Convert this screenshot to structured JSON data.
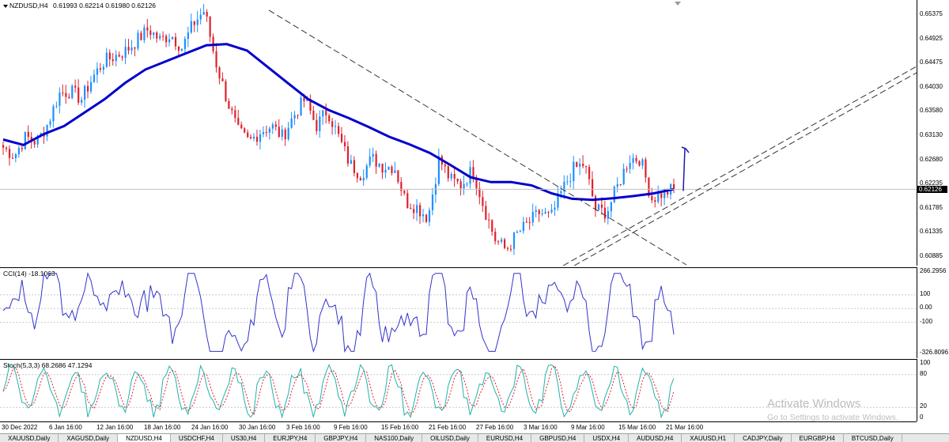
{
  "main": {
    "symbol": "NZDUSD,H4",
    "ohlc": "0.61993 0.62214 0.61980 0.62126",
    "current_price": "0.62126",
    "price_ticks": [
      "0.65375",
      "0.64925",
      "0.64475",
      "0.64030",
      "0.63580",
      "0.63130",
      "0.62680",
      "0.62235",
      "0.61785",
      "0.61335",
      "0.60885"
    ]
  },
  "cci": {
    "title": "CCI(14) -18.1063",
    "ticks": [
      "266.2956",
      "100",
      "0.00",
      "-100",
      "-326.8096"
    ]
  },
  "stoch": {
    "title": "Stoch(5,3,3) 68.2686 47.1294",
    "ticks": [
      "100",
      "80",
      "20",
      "0"
    ]
  },
  "time_axis": [
    "30 Dec 2022",
    "6 Jan 16:00",
    "12 Jan 16:00",
    "18 Jan 16:00",
    "24 Jan 16:00",
    "30 Jan 16:00",
    "3 Feb 16:00",
    "9 Feb 16:00",
    "15 Feb 16:00",
    "21 Feb 16:00",
    "27 Feb 16:00",
    "3 Mar 16:00",
    "9 Mar 16:00",
    "15 Mar 16:00",
    "21 Mar 16:00"
  ],
  "tabs": [
    {
      "label": "XAUUSD,Daily",
      "active": false
    },
    {
      "label": "XAGUSD,Daily",
      "active": false
    },
    {
      "label": "NZDUSD,H4",
      "active": true
    },
    {
      "label": "USDCHF,H4",
      "active": false
    },
    {
      "label": "US30,H4",
      "active": false
    },
    {
      "label": "EURJPY,H4",
      "active": false
    },
    {
      "label": "GBPJPY,H4",
      "active": false
    },
    {
      "label": "NAS100,Daily",
      "active": false
    },
    {
      "label": "OILUSD,Daily",
      "active": false
    },
    {
      "label": "EURUSD,H4",
      "active": false
    },
    {
      "label": "GBPUSD,H4",
      "active": false
    },
    {
      "label": "USDX,H4",
      "active": false
    },
    {
      "label": "AUDUSD,H4",
      "active": false
    },
    {
      "label": "XAUUSD,H1",
      "active": false
    },
    {
      "label": "CADJPY,Daily",
      "active": false
    },
    {
      "label": "EURGBP,H4",
      "active": false
    },
    {
      "label": "BTCUSD,Daily",
      "active": false
    }
  ],
  "watermark": {
    "line1": "Activate Windows",
    "line2": "Go to Settings to activate Windows."
  },
  "colors": {
    "bull": "#1e90ff",
    "bear": "#e0202c",
    "ma": "#0000cc",
    "cci": "#3333cc",
    "stoch_main": "#20b2aa",
    "stoch_signal": "#e0202c"
  },
  "chart_data": {
    "type": "candlestick",
    "price_range": [
      0.6085,
      0.656
    ],
    "price_path": [
      0.629,
      0.6275,
      0.631,
      0.63,
      0.6335,
      0.639,
      0.6395,
      0.638,
      0.642,
      0.645,
      0.646,
      0.647,
      0.649,
      0.651,
      0.649,
      0.65,
      0.6475,
      0.652,
      0.6545,
      0.645,
      0.638,
      0.632,
      0.63,
      0.632,
      0.633,
      0.631,
      0.635,
      0.638,
      0.633,
      0.636,
      0.631,
      0.626,
      0.624,
      0.627,
      0.6255,
      0.6255,
      0.619,
      0.618,
      0.616,
      0.627,
      0.623,
      0.622,
      0.625,
      0.618,
      0.612,
      0.61,
      0.613,
      0.615,
      0.617,
      0.616,
      0.621,
      0.625,
      0.626,
      0.6175,
      0.617,
      0.622,
      0.627,
      0.627,
      0.6195,
      0.6205,
      0.6213
    ],
    "ma_path": [
      0.6305,
      0.6295,
      0.6315,
      0.633,
      0.6355,
      0.638,
      0.641,
      0.6435,
      0.645,
      0.6465,
      0.648,
      0.6482,
      0.647,
      0.644,
      0.641,
      0.638,
      0.636,
      0.6345,
      0.6328,
      0.631,
      0.6296,
      0.628,
      0.6258,
      0.6235,
      0.6226,
      0.6226,
      0.622,
      0.6205,
      0.6195,
      0.6193,
      0.6196,
      0.62,
      0.6205,
      0.6213
    ],
    "cci_range": [
      -326.8096,
      266.2956
    ],
    "stoch_range": [
      0,
      100
    ],
    "drawn_objects": [
      "downtrend line",
      "ascending channel",
      "up arrow"
    ]
  }
}
